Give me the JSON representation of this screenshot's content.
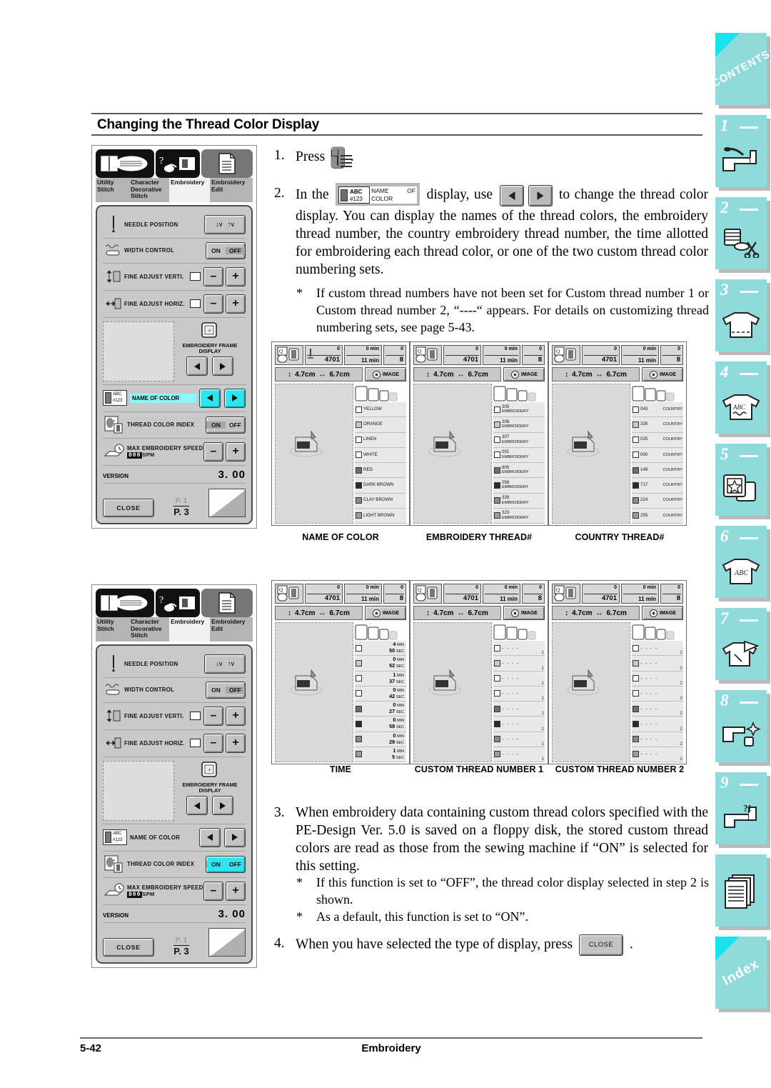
{
  "page": {
    "heading": "Changing the Thread Color Display",
    "folio": "5-42",
    "footer_title": "Embroidery"
  },
  "steps": {
    "s1_num": "1.",
    "s1_pre": "Press",
    "s1_post": ".",
    "s2_num": "2.",
    "s2_pre": "In the",
    "s2_mid": "display, use",
    "s2_post": "to change the thread color display. You can display the names of the thread colors, the embroidery thread number, the country embroidery thread number, the time allotted for embroidering each thread color, or one of the two custom thread color numbering sets.",
    "s2_note_ast": "*",
    "s2_note": "If custom thread numbers have not been set for Custom thread number 1 or Custom thread number 2, “----“ appears. For details on customizing thread numbering sets, see page 5-43.",
    "s3_num": "3.",
    "s3": "When embroidery data containing custom thread colors specified with the PE-Design Ver. 5.0 is saved on a floppy disk, the stored custom thread colors are read as those from the sewing machine if “ON” is selected for this setting.",
    "s3_note1_ast": "*",
    "s3_note1": "If this function is set to “OFF”, the thread color display selected in step 2 is shown.",
    "s3_note2_ast": "*",
    "s3_note2": "As a default, this function is set to “ON”.",
    "s4_num": "4.",
    "s4_pre": "When you have selected the type of display, press",
    "s4_post": ".",
    "close_key_label": "CLOSE",
    "name_of_color_key": {
      "abc": "ABC",
      "hash": "#123",
      "label": "NAME OF COLOR"
    }
  },
  "lcd_tabs": [
    {
      "label": "Utility Stitch",
      "selected": false
    },
    {
      "label": "Character Decorative Stitch",
      "selected": false
    },
    {
      "label": "Embroidery",
      "selected": true
    },
    {
      "label": "Embroidery Edit",
      "selected": false
    }
  ],
  "lcd_panel": {
    "rows": [
      {
        "name": "needle-position",
        "label": "NEEDLE POSITION",
        "control": "needle"
      },
      {
        "name": "width-control",
        "label": "WIDTH CONTROL",
        "control": "onoff",
        "on": "ON",
        "off": "OFF",
        "selected": "OFF"
      },
      {
        "name": "fine-adjust-verti",
        "label": "FINE ADJUST VERTI.",
        "control": "plusminus",
        "minus": "–",
        "plus": "+"
      },
      {
        "name": "fine-adjust-horiz",
        "label": "FINE ADJUST HORIZ.",
        "control": "plusminus",
        "minus": "–",
        "plus": "+"
      }
    ],
    "frame_display_label": "EMBROIDERY FRAME DISPLAY",
    "name_of_color_label": "NAME OF COLOR",
    "name_of_color_abc": "ABC",
    "name_of_color_hash": "#123",
    "thread_color_index_label": "THREAD COLOR INDEX",
    "thread_index_on": "ON",
    "thread_index_off": "OFF",
    "max_speed_label": "MAX EMBROIDERY SPEED",
    "max_speed_value": "800",
    "max_speed_unit": "SPM",
    "version_label": "VERSION",
    "version_value": "3. 00",
    "close_label": "CLOSE",
    "page_prev": "P. 1",
    "page_cur": "P. 3"
  },
  "lcd_panel_2_highlight": "thread-color-index",
  "lcd_panel_1_highlight": "name-of-color",
  "thumb_common": {
    "stitch_count": "4701",
    "stitch_count_top": "0",
    "time_top": "0 min",
    "time_bottom": "11 min",
    "color_top": "0",
    "color_bottom": "8",
    "height_value": "4.7cm",
    "width_value": "6.7cm",
    "image_label": "IMAGE"
  },
  "thumbnails": [
    {
      "name": "name-of-color",
      "caption": "NAME OF COLOR",
      "mode": "names",
      "items": [
        {
          "swatch": "#ffffff",
          "text": "YELLOW"
        },
        {
          "swatch": "#c9c9c9",
          "text": "ORANGE"
        },
        {
          "swatch": "#ffffff",
          "text": "LINEN"
        },
        {
          "swatch": "#ffffff",
          "text": "WHITE"
        },
        {
          "swatch": "#6e6e6e",
          "text": "RED"
        },
        {
          "swatch": "#2b2b2b",
          "text": "DARK BROWN"
        },
        {
          "swatch": "#8a8a8a",
          "text": "CLAY BROWN"
        },
        {
          "swatch": "#9c9c9c",
          "text": "LIGHT BROWN"
        }
      ]
    },
    {
      "name": "embroidery-thread-number",
      "caption": "EMBROIDERY THREAD#",
      "mode": "number_sub",
      "sub": "EMBROIDERY",
      "items": [
        {
          "swatch": "#ffffff",
          "text": "205"
        },
        {
          "swatch": "#c9c9c9",
          "text": "208"
        },
        {
          "swatch": "#ffffff",
          "text": "307"
        },
        {
          "swatch": "#ffffff",
          "text": "001"
        },
        {
          "swatch": "#6e6e6e",
          "text": "800"
        },
        {
          "swatch": "#2b2b2b",
          "text": "058"
        },
        {
          "swatch": "#8a8a8a",
          "text": "339"
        },
        {
          "swatch": "#9c9c9c",
          "text": "323"
        }
      ]
    },
    {
      "name": "country-thread-number",
      "caption": "COUNTRY THREAD#",
      "mode": "number_sub",
      "sub": "COUNTRY",
      "items": [
        {
          "swatch": "#ffffff",
          "text": "043"
        },
        {
          "swatch": "#c9c9c9",
          "text": "335"
        },
        {
          "swatch": "#ffffff",
          "text": "025"
        },
        {
          "swatch": "#ffffff",
          "text": "000"
        },
        {
          "swatch": "#6e6e6e",
          "text": "149"
        },
        {
          "swatch": "#2b2b2b",
          "text": "717"
        },
        {
          "swatch": "#8a8a8a",
          "text": "224"
        },
        {
          "swatch": "#9c9c9c",
          "text": "255"
        }
      ]
    },
    {
      "name": "time",
      "caption": "TIME",
      "mode": "time",
      "items": [
        {
          "swatch": "#ffffff",
          "min": "4",
          "sec": "50"
        },
        {
          "swatch": "#c9c9c9",
          "min": "0",
          "sec": "52"
        },
        {
          "swatch": "#ffffff",
          "min": "1",
          "sec": "37"
        },
        {
          "swatch": "#ffffff",
          "min": "0",
          "sec": "42"
        },
        {
          "swatch": "#6e6e6e",
          "min": "0",
          "sec": "27"
        },
        {
          "swatch": "#2b2b2b",
          "min": "0",
          "sec": "58"
        },
        {
          "swatch": "#8a8a8a",
          "min": "0",
          "sec": "28"
        },
        {
          "swatch": "#9c9c9c",
          "min": "1",
          "sec": "5"
        }
      ],
      "unit_min": "MIN",
      "unit_sec": "SEC"
    },
    {
      "name": "custom-thread-number-1",
      "caption": "CUSTOM THREAD NUMBER 1",
      "mode": "dash",
      "dash": "- - - -",
      "index": "1",
      "items": [
        {
          "swatch": "#ffffff"
        },
        {
          "swatch": "#c9c9c9"
        },
        {
          "swatch": "#ffffff"
        },
        {
          "swatch": "#ffffff"
        },
        {
          "swatch": "#6e6e6e"
        },
        {
          "swatch": "#2b2b2b"
        },
        {
          "swatch": "#8a8a8a"
        },
        {
          "swatch": "#9c9c9c"
        }
      ]
    },
    {
      "name": "custom-thread-number-2",
      "caption": "CUSTOM THREAD NUMBER 2",
      "mode": "dash",
      "dash": "- - - -",
      "index": "2",
      "items": [
        {
          "swatch": "#ffffff"
        },
        {
          "swatch": "#c9c9c9"
        },
        {
          "swatch": "#ffffff"
        },
        {
          "swatch": "#ffffff"
        },
        {
          "swatch": "#6e6e6e"
        },
        {
          "swatch": "#2b2b2b"
        },
        {
          "swatch": "#8a8a8a"
        },
        {
          "swatch": "#9c9c9c"
        }
      ]
    }
  ],
  "chapter_tabs": [
    {
      "name": "contents",
      "label": "CONTENTS",
      "kind": "diag"
    },
    {
      "name": "chapter-1",
      "label": "1",
      "kind": "num",
      "icon": "sewing-machine-icon"
    },
    {
      "name": "chapter-2",
      "label": "2",
      "kind": "num",
      "icon": "spool-scissors-icon"
    },
    {
      "name": "chapter-3",
      "label": "3",
      "kind": "num",
      "icon": "shirt-stitch-icon"
    },
    {
      "name": "chapter-4",
      "label": "4",
      "kind": "num",
      "icon": "shirt-abc-icon"
    },
    {
      "name": "chapter-5",
      "label": "5",
      "kind": "num",
      "icon": "hoop-star-icon"
    },
    {
      "name": "chapter-6",
      "label": "6",
      "kind": "num",
      "icon": "shirt-script-icon"
    },
    {
      "name": "chapter-7",
      "label": "7",
      "kind": "num",
      "icon": "shirt-needle-icon"
    },
    {
      "name": "chapter-8",
      "label": "8",
      "kind": "num",
      "icon": "machine-clean-icon"
    },
    {
      "name": "chapter-9",
      "label": "9",
      "kind": "num",
      "icon": "machine-help-icon"
    },
    {
      "name": "appendix",
      "label": "",
      "kind": "plain",
      "icon": "pages-icon"
    },
    {
      "name": "index",
      "label": "Index",
      "kind": "diag"
    }
  ],
  "colors": {
    "tab_teal": "#8fdada",
    "tab_corner": "#19e3ee",
    "lcd_highlight_cyan": "#2ee4ef",
    "lcd_body_gray": "#c9c9c9"
  }
}
